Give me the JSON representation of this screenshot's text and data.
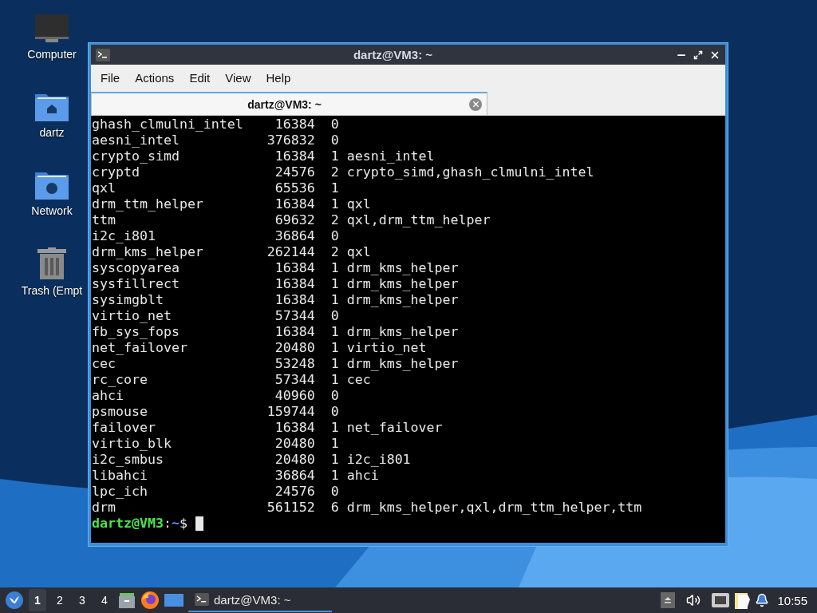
{
  "desktop_icons": [
    {
      "label": "Computer",
      "kind": "computer"
    },
    {
      "label": "dartz",
      "kind": "home"
    },
    {
      "label": "Network",
      "kind": "network"
    },
    {
      "label": "Trash (Empt",
      "kind": "trash"
    }
  ],
  "window": {
    "title": "dartz@VM3: ~",
    "menu": [
      "File",
      "Actions",
      "Edit",
      "View",
      "Help"
    ],
    "tabs": [
      {
        "label": "dartz@VM3: ~",
        "selected": true
      }
    ],
    "terminal": {
      "rows": [
        {
          "module": "ghash_clmulni_intel",
          "size": "16384",
          "used": "0"
        },
        {
          "module": "aesni_intel",
          "size": "376832",
          "used": "0"
        },
        {
          "module": "crypto_simd",
          "size": "16384",
          "used": "1",
          "by": "aesni_intel"
        },
        {
          "module": "cryptd",
          "size": "24576",
          "used": "2",
          "by": "crypto_simd,ghash_clmulni_intel"
        },
        {
          "module": "qxl",
          "size": "65536",
          "used": "1"
        },
        {
          "module": "drm_ttm_helper",
          "size": "16384",
          "used": "1",
          "by": "qxl"
        },
        {
          "module": "ttm",
          "size": "69632",
          "used": "2",
          "by": "qxl,drm_ttm_helper"
        },
        {
          "module": "i2c_i801",
          "size": "36864",
          "used": "0"
        },
        {
          "module": "drm_kms_helper",
          "size": "262144",
          "used": "2",
          "by": "qxl"
        },
        {
          "module": "syscopyarea",
          "size": "16384",
          "used": "1",
          "by": "drm_kms_helper"
        },
        {
          "module": "sysfillrect",
          "size": "16384",
          "used": "1",
          "by": "drm_kms_helper"
        },
        {
          "module": "sysimgblt",
          "size": "16384",
          "used": "1",
          "by": "drm_kms_helper"
        },
        {
          "module": "virtio_net",
          "size": "57344",
          "used": "0"
        },
        {
          "module": "fb_sys_fops",
          "size": "16384",
          "used": "1",
          "by": "drm_kms_helper"
        },
        {
          "module": "net_failover",
          "size": "20480",
          "used": "1",
          "by": "virtio_net"
        },
        {
          "module": "cec",
          "size": "53248",
          "used": "1",
          "by": "drm_kms_helper"
        },
        {
          "module": "rc_core",
          "size": "57344",
          "used": "1",
          "by": "cec"
        },
        {
          "module": "ahci",
          "size": "40960",
          "used": "0"
        },
        {
          "module": "psmouse",
          "size": "159744",
          "used": "0"
        },
        {
          "module": "failover",
          "size": "16384",
          "used": "1",
          "by": "net_failover"
        },
        {
          "module": "virtio_blk",
          "size": "20480",
          "used": "1"
        },
        {
          "module": "i2c_smbus",
          "size": "20480",
          "used": "1",
          "by": "i2c_i801"
        },
        {
          "module": "libahci",
          "size": "36864",
          "used": "1",
          "by": "ahci"
        },
        {
          "module": "lpc_ich",
          "size": "24576",
          "used": "0"
        },
        {
          "module": "drm",
          "size": "561152",
          "used": "6",
          "by": "drm_kms_helper,qxl,drm_ttm_helper,ttm"
        }
      ],
      "prompt": {
        "user_host": "dartz@VM3",
        "separator": ":",
        "path": "~",
        "symbol": "$"
      }
    }
  },
  "taskbar": {
    "workspaces": [
      {
        "label": "1",
        "selected": true
      },
      {
        "label": "2",
        "selected": false
      },
      {
        "label": "3",
        "selected": false
      },
      {
        "label": "4",
        "selected": false
      }
    ],
    "tasks": [
      {
        "label": "dartz@VM3: ~",
        "selected": true
      }
    ],
    "clock": "10:55"
  }
}
